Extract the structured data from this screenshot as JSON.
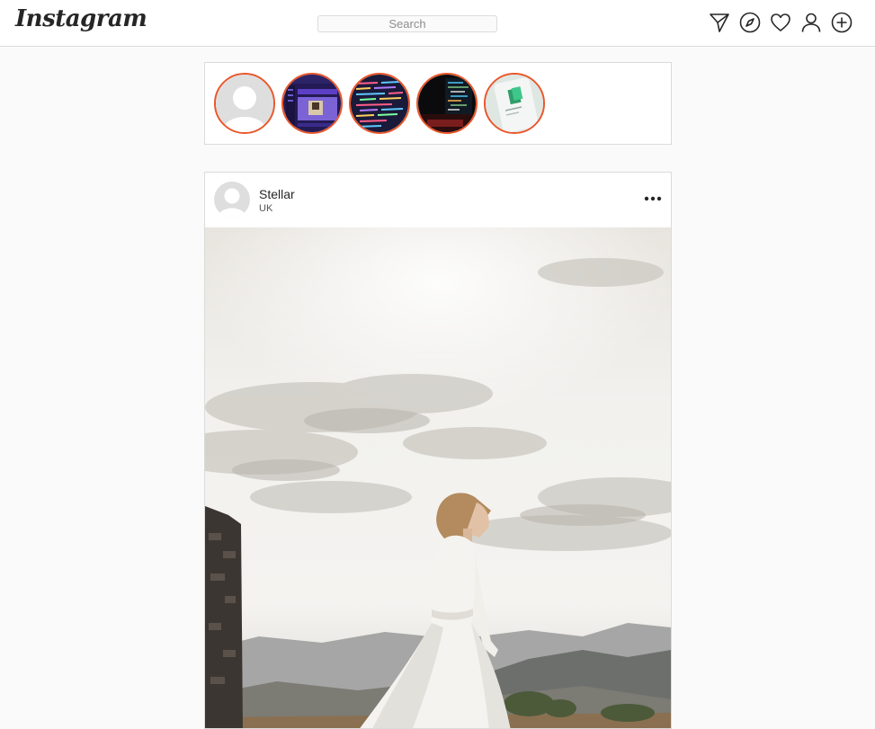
{
  "app": {
    "logo": "Instagram"
  },
  "search": {
    "placeholder": "Search"
  },
  "nav_icons": [
    "direct-message-icon",
    "explore-compass-icon",
    "activity-heart-icon",
    "profile-icon",
    "new-post-icon"
  ],
  "stories": [
    {
      "name": "default-avatar"
    },
    {
      "name": "chat-app-screenshot"
    },
    {
      "name": "colorful-code-screen"
    },
    {
      "name": "dark-code-monitor"
    },
    {
      "name": "phone-app-screen"
    }
  ],
  "post": {
    "username": "Stellar",
    "location": "UK",
    "image_description_icon": "woman-white-dress-photo"
  },
  "colors": {
    "story_ring": "#e9572b",
    "border": "#dbdbdb",
    "background": "#fafafa"
  }
}
